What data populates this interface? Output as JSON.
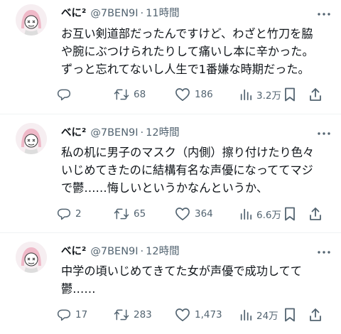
{
  "tweets": [
    {
      "name": "べに²",
      "handle": "@7BEN9I",
      "separator": "·",
      "time": "11時間",
      "lines": [
        "お互い剣道部だったんですけど、わざと竹刀を脇",
        "や腕にぶつけられたりして痛いし本に辛かった。",
        "ずっと忘れてないし人生で1番嫌な時期だった。"
      ],
      "replies": "",
      "retweets": "68",
      "likes": "186",
      "views": "3.2万"
    },
    {
      "name": "べに²",
      "handle": "@7BEN9I",
      "separator": "·",
      "time": "12時間",
      "lines": [
        "私の机に男子のマスク（内側）擦り付けたり色々",
        "いじめてきたのに結構有名な声優になっててマジ",
        "で鬱……悔しいというかなんというか、"
      ],
      "replies": "2",
      "retweets": "65",
      "likes": "364",
      "views": "6.6万"
    },
    {
      "name": "べに²",
      "handle": "@7BEN9I",
      "separator": "·",
      "time": "12時間",
      "lines": [
        "中学の頃いじめてきてた女が声優で成功してて",
        "鬱……"
      ],
      "replies": "17",
      "retweets": "283",
      "likes": "1,473",
      "views": "24万"
    }
  ],
  "colors": {
    "text": "#0f1419",
    "muted": "#536471",
    "divider": "#eff3f4"
  }
}
